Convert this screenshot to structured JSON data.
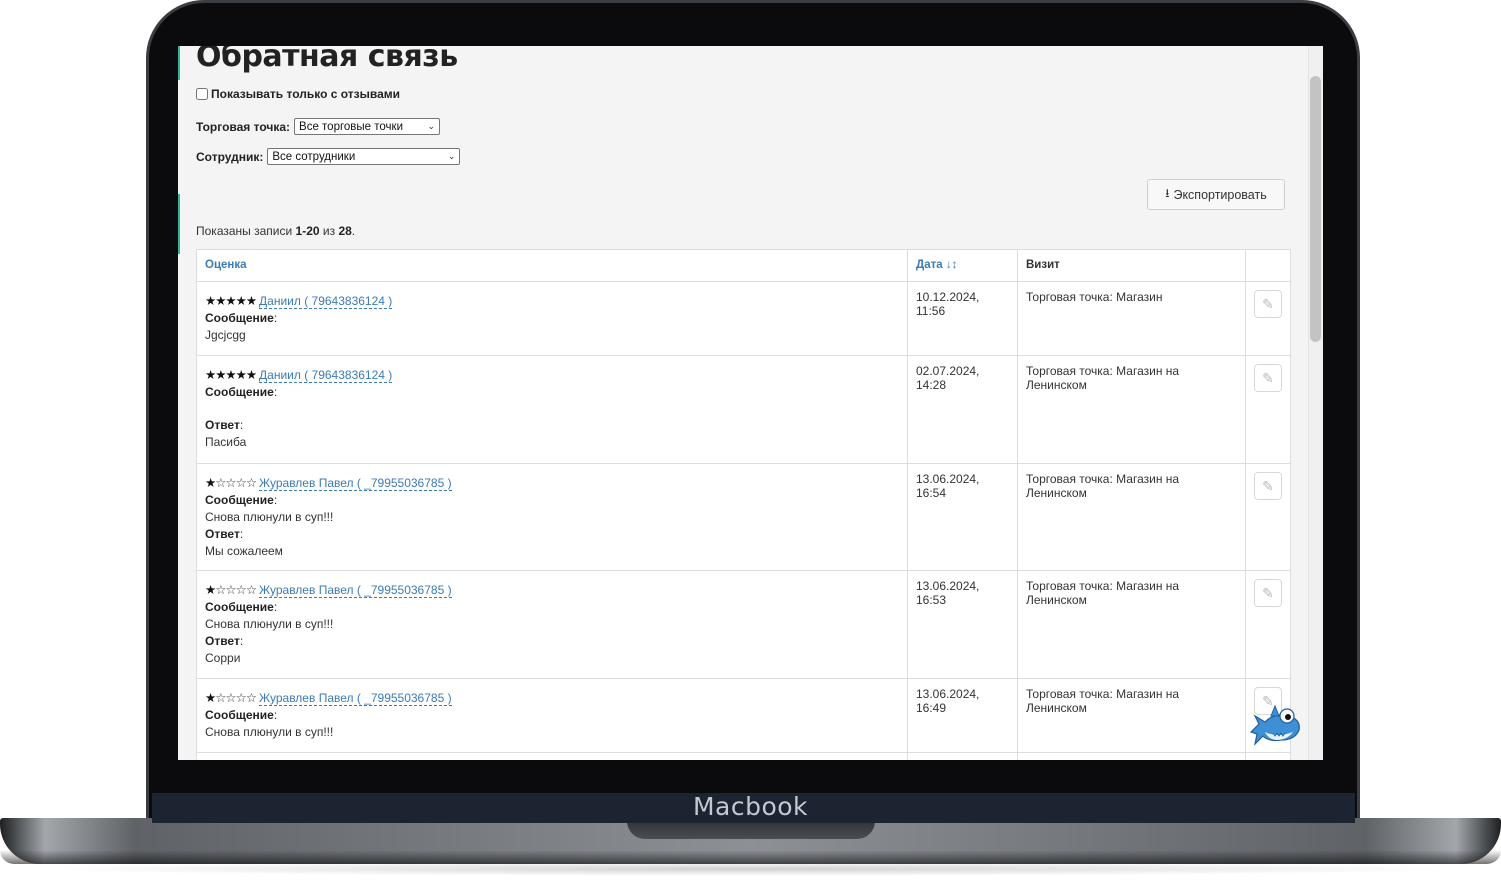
{
  "device": {
    "brand": "Macbook"
  },
  "page": {
    "title": "Обратная связь",
    "only_with_reviews_label": "Показывать только с отзывами",
    "store_filter": {
      "label": "Торговая точка:",
      "value": "Все торговые точки"
    },
    "employee_filter": {
      "label": "Сотрудник:",
      "value": "Все сотрудники"
    },
    "export_label": "Экспортировать",
    "summary": {
      "prefix": "Показаны записи ",
      "range": "1-20",
      "middle": " из ",
      "total": "28",
      "suffix": "."
    }
  },
  "table": {
    "headers": {
      "rating": "Оценка",
      "date": "Дата",
      "visit": "Визит"
    },
    "rows": [
      {
        "stars_full": "★★★★★",
        "stars_empty": "",
        "author": "Даниил ( 79643836124 )",
        "message_label": "Сообщение",
        "message": "Jgcjcgg",
        "answer_label": "",
        "answer": "",
        "date": "10.12.2024, 11:56",
        "visit": "Торговая точка: Магазин"
      },
      {
        "stars_full": "★★★★★",
        "stars_empty": "",
        "author": "Даниил ( 79643836124 )",
        "message_label": "Сообщение",
        "message": "",
        "answer_label": "Ответ",
        "answer": "Пасиба",
        "date": "02.07.2024, 14:28",
        "visit": "Торговая точка: Магазин на Ленинском"
      },
      {
        "stars_full": "★",
        "stars_empty": "☆☆☆☆",
        "author": "Журавлев Павел ( _79955036785 )",
        "message_label": "Сообщение",
        "message": "Снова плюнули в суп!!!",
        "answer_label": "Ответ",
        "answer": "Мы сожалеем",
        "date": "13.06.2024, 16:54",
        "visit": "Торговая точка: Магазин на Ленинском"
      },
      {
        "stars_full": "★",
        "stars_empty": "☆☆☆☆",
        "author": "Журавлев Павел ( _79955036785 )",
        "message_label": "Сообщение",
        "message": "Снова плюнули в суп!!!",
        "answer_label": "Ответ",
        "answer": "Сорри",
        "date": "13.06.2024, 16:53",
        "visit": "Торговая точка: Магазин на Ленинском"
      },
      {
        "stars_full": "★",
        "stars_empty": "☆☆☆☆",
        "author": "Журавлев Павел ( _79955036785 )",
        "message_label": "Сообщение",
        "message": "Снова плюнули в суп!!!",
        "answer_label": "",
        "answer": "",
        "date": "13.06.2024, 16:49",
        "visit": "Торговая точка: Магазин на Ленинском"
      }
    ]
  },
  "icons": {
    "edit": "pencil-icon",
    "export": "export-icon",
    "sort": "sort-icon",
    "mascot": "shark-mascot-icon"
  },
  "colors": {
    "link": "#3c7ab5",
    "accent": "#2fb59a"
  }
}
